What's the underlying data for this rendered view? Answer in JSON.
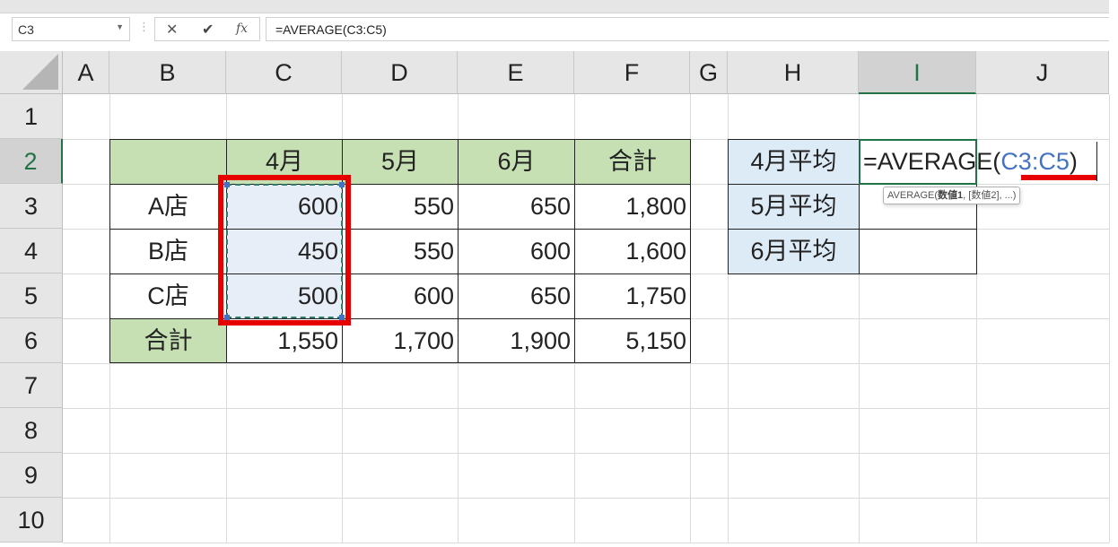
{
  "formula_bar": {
    "name_box": "C3",
    "cancel_icon": "✕",
    "enter_icon": "✔",
    "fx_label": "fx",
    "formula": "=AVERAGE(C3:C5)"
  },
  "columns": [
    "A",
    "B",
    "C",
    "D",
    "E",
    "F",
    "G",
    "H",
    "I",
    "J"
  ],
  "selected_column": "I",
  "rows": [
    "1",
    "2",
    "3",
    "4",
    "5",
    "6",
    "7",
    "8",
    "9",
    "10"
  ],
  "selected_row": "2",
  "sales_table": {
    "header": [
      "",
      "4月",
      "5月",
      "6月",
      "合計"
    ],
    "rows": [
      {
        "store": "A店",
        "values": [
          "600",
          "550",
          "650",
          "1,800"
        ]
      },
      {
        "store": "B店",
        "values": [
          "450",
          "550",
          "600",
          "1,600"
        ]
      },
      {
        "store": "C店",
        "values": [
          "500",
          "600",
          "650",
          "1,750"
        ]
      }
    ],
    "total_row": {
      "label": "合計",
      "values": [
        "1,550",
        "1,700",
        "1,900",
        "5,150"
      ]
    }
  },
  "average_table": {
    "labels": [
      "4月平均",
      "5月平均",
      "6月平均"
    ],
    "values": [
      "",
      "",
      ""
    ]
  },
  "editing": {
    "prefix": "=AVERAGE(",
    "range_ref": "C3:C5",
    "suffix": ")",
    "tooltip_fn": "AVERAGE(",
    "tooltip_arg1": "数値1",
    "tooltip_rest": ", [数値2], ...)"
  },
  "colors": {
    "header_fill": "#c6e0b4",
    "average_label_fill": "#ddebf7",
    "highlight_red": "#e60000",
    "excel_green": "#217346",
    "reference_blue": "#4472c4"
  }
}
